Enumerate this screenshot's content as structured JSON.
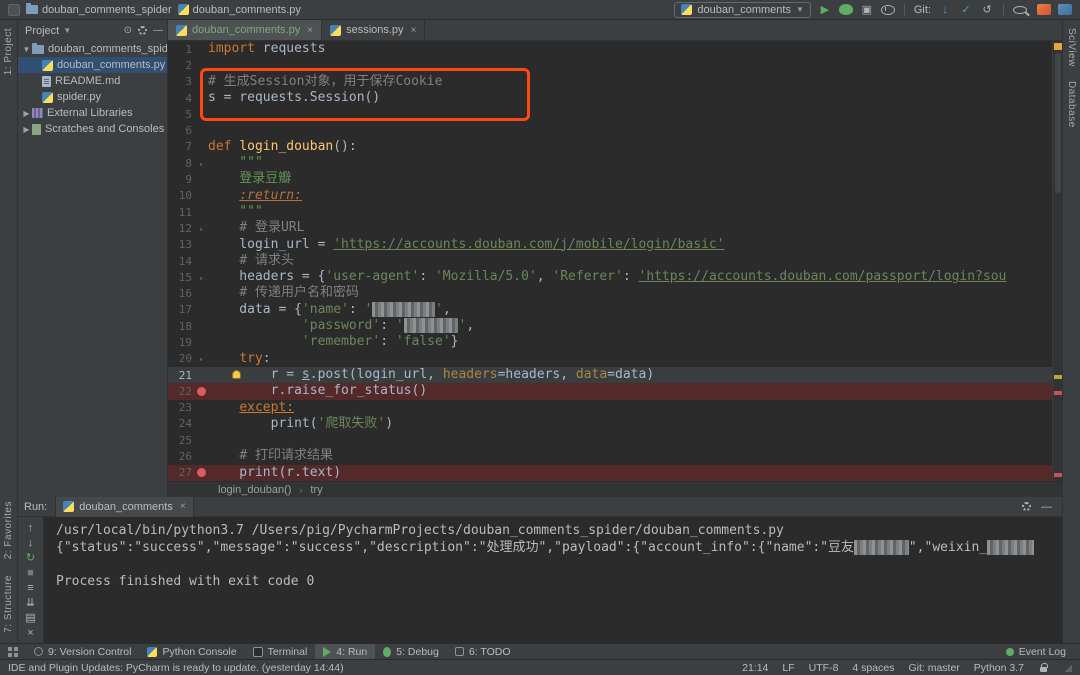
{
  "titlebar": {
    "project_crumb": "douban_comments_spider",
    "file_crumb": "douban_comments.py",
    "run_config": "douban_comments",
    "icons": [
      {
        "name": "run-icon",
        "g": "▶",
        "c": "#5fad65"
      },
      {
        "name": "debug-icon",
        "shape": "bug"
      },
      {
        "name": "coverage-icon",
        "g": "▣",
        "c": "#afb1b3"
      },
      {
        "name": "profiler-icon",
        "shape": "clock"
      },
      {
        "name": "sep"
      },
      {
        "name": "git-label",
        "text": "Git:"
      },
      {
        "name": "git-update-icon",
        "g": "↓",
        "c": "#4a9bd5"
      },
      {
        "name": "git-commit-icon",
        "g": "✓",
        "c": "#5fad65"
      },
      {
        "name": "git-rollback-icon",
        "g": "↺",
        "c": "#afb1b3"
      },
      {
        "name": "sep"
      },
      {
        "name": "search-icon",
        "shape": "magnifier"
      },
      {
        "name": "plugin-icon",
        "shape": "plug1"
      },
      {
        "name": "sync-icon",
        "shape": "plug2"
      }
    ]
  },
  "strips": {
    "left_top": "1: Project",
    "left_bottom": [
      "2: Favorites",
      "7: Structure"
    ],
    "right": [
      "SciView",
      "Database"
    ]
  },
  "project": {
    "header": "Project",
    "items": [
      {
        "label": "douban_comments_spider",
        "icon": "folder",
        "chev": "down",
        "indent": 0
      },
      {
        "label": "douban_comments.py",
        "icon": "py",
        "indent": 1,
        "selected": true
      },
      {
        "label": "README.md",
        "icon": "doc",
        "indent": 1
      },
      {
        "label": "spider.py",
        "icon": "py",
        "indent": 1
      },
      {
        "label": "External Libraries",
        "icon": "lib",
        "chev": "right",
        "indent": 0
      },
      {
        "label": "Scratches and Consoles",
        "icon": "scratch",
        "chev": "right",
        "indent": 0
      }
    ]
  },
  "tabs": [
    {
      "label": "douban_comments.py",
      "active": true
    },
    {
      "label": "sessions.py"
    }
  ],
  "editor": {
    "breadcrumbs": [
      "login_douban()",
      "try"
    ],
    "lines": [
      {
        "seg": [
          [
            "import",
            "k"
          ],
          [
            " requests",
            ""
          ]
        ]
      },
      {
        "seg": []
      },
      {
        "seg": [
          [
            "# 生成Session对象，用于保存Cookie",
            "c"
          ]
        ]
      },
      {
        "seg": [
          [
            "s = requests.Session()",
            ""
          ]
        ]
      },
      {
        "seg": []
      },
      {
        "seg": []
      },
      {
        "seg": [
          [
            "def ",
            "k"
          ],
          [
            "login_douban",
            "f"
          ],
          [
            "():",
            ""
          ]
        ]
      },
      {
        "seg": [
          [
            "    \"\"\"",
            "d"
          ]
        ],
        "mark": "fold"
      },
      {
        "seg": [
          [
            "    登录豆瓣",
            "d"
          ]
        ]
      },
      {
        "seg": [
          [
            "    ",
            ""
          ],
          [
            ":return:",
            "t"
          ]
        ]
      },
      {
        "seg": [
          [
            "    \"\"\"",
            "d"
          ]
        ]
      },
      {
        "seg": [
          [
            "    ",
            ""
          ],
          [
            "# 登录URL",
            "c"
          ]
        ],
        "mark": "fold"
      },
      {
        "seg": [
          [
            "    login_url = ",
            ""
          ],
          [
            "'https://accounts.douban.com/j/mobile/login/basic'",
            "su"
          ]
        ]
      },
      {
        "seg": [
          [
            "    ",
            ""
          ],
          [
            "# 请求头",
            "c"
          ]
        ]
      },
      {
        "seg": [
          [
            "    headers = {",
            ""
          ],
          [
            "'user-agent'",
            "s"
          ],
          [
            ": ",
            ""
          ],
          [
            "'Mozilla/5.0'",
            "s"
          ],
          [
            ", ",
            ""
          ],
          [
            "'Referer'",
            "s"
          ],
          [
            ": ",
            ""
          ],
          [
            "'https://accounts.douban.com/passport/login?sou",
            "su"
          ]
        ],
        "mark": "fold"
      },
      {
        "seg": [
          [
            "    ",
            ""
          ],
          [
            "# 传递用户名和密码",
            "c"
          ]
        ]
      },
      {
        "seg": [
          [
            "    data = {",
            ""
          ],
          [
            "'name'",
            "s"
          ],
          [
            ": ",
            ""
          ],
          [
            "'",
            "s"
          ],
          [
            "        ",
            "z"
          ],
          [
            "'",
            "s"
          ],
          [
            ",",
            ""
          ]
        ]
      },
      {
        "seg": [
          [
            "            ",
            ""
          ],
          [
            "'password'",
            "s"
          ],
          [
            ": ",
            ""
          ],
          [
            "'",
            "s"
          ],
          [
            "       ",
            "z"
          ],
          [
            "'",
            "s"
          ],
          [
            ",",
            ""
          ]
        ]
      },
      {
        "seg": [
          [
            "            ",
            ""
          ],
          [
            "'remember'",
            "s"
          ],
          [
            ": ",
            ""
          ],
          [
            "'false'",
            "s"
          ],
          [
            "}",
            ""
          ]
        ]
      },
      {
        "seg": [
          [
            "    ",
            ""
          ],
          [
            "try",
            "k"
          ],
          [
            ":",
            ""
          ]
        ],
        "mark": "fold"
      },
      {
        "seg": [
          [
            "        r = ",
            ""
          ],
          [
            "s",
            "nu"
          ],
          [
            ".post(login_url, ",
            ""
          ],
          [
            "headers",
            "a"
          ],
          [
            "=headers, ",
            ""
          ],
          [
            "data",
            "a"
          ],
          [
            "=data)",
            ""
          ]
        ],
        "bg": "cur",
        "bulb": true
      },
      {
        "seg": [
          [
            "        r.raise_for_status()",
            ""
          ]
        ],
        "bg": "bp",
        "mark": "bp"
      },
      {
        "seg": [
          [
            "    ",
            ""
          ],
          [
            "except:",
            "ku"
          ]
        ]
      },
      {
        "seg": [
          [
            "        print(",
            ""
          ],
          [
            "'爬取失败'",
            "s"
          ],
          [
            ")",
            ""
          ]
        ]
      },
      {
        "seg": []
      },
      {
        "seg": [
          [
            "    ",
            ""
          ],
          [
            "# 打印请求结果",
            "c"
          ]
        ]
      },
      {
        "seg": [
          [
            "    print(r.text)",
            ""
          ]
        ],
        "bg": "bp",
        "mark": "bp"
      }
    ]
  },
  "run": {
    "title": "Run:",
    "tab": "douban_comments",
    "icons": [
      {
        "name": "up-stack-trace-icon",
        "g": "↑"
      },
      {
        "name": "down-stack-trace-icon",
        "g": "↓"
      },
      {
        "name": "rerun-icon",
        "g": "↻",
        "c": "#5fad65"
      },
      {
        "name": "stop-icon",
        "g": "■",
        "c": "#77797b"
      },
      {
        "name": "soft-wrap-icon",
        "g": "≡"
      },
      {
        "name": "scroll-to-end-icon",
        "g": "⇊"
      },
      {
        "name": "print-icon",
        "g": "▤"
      },
      {
        "name": "clear-all-icon",
        "g": "×"
      }
    ],
    "console": [
      {
        "seg": [
          [
            "/usr/local/bin/python3.7 /Users/pig/PycharmProjects/douban_comments_spider/douban_comments.py",
            ""
          ]
        ]
      },
      {
        "seg": [
          [
            "{\"status\":\"success\",\"message\":\"success\",\"description\":\"处理成功\",\"payload\":{\"account_info\":{\"name\":\"豆友",
            ""
          ],
          [
            "       ",
            "z"
          ],
          [
            "\",\"weixin_",
            ""
          ],
          [
            "      ",
            "z"
          ]
        ]
      },
      {
        "seg": []
      },
      {
        "seg": [
          [
            "Process finished with exit code 0",
            ""
          ]
        ]
      }
    ]
  },
  "toolbar_bottom": {
    "items": [
      {
        "label": "9: Version Control",
        "icon": "vcs"
      },
      {
        "label": "Python Console",
        "icon": "py"
      },
      {
        "label": "Terminal",
        "icon": "term"
      },
      {
        "label": "4: Run",
        "icon": "run",
        "active": true
      },
      {
        "label": "5: Debug",
        "icon": "debug"
      },
      {
        "label": "6: TODO",
        "icon": "todo"
      }
    ],
    "event_log": "Event Log"
  },
  "statusbar": {
    "message": "IDE and Plugin Updates: PyCharm is ready to update. (yesterday 14:44)",
    "items": [
      "21:14",
      "LF",
      "UTF-8",
      "4 spaces",
      "Git: master",
      "Python 3.7"
    ]
  },
  "annotation_color": "#ff4714"
}
